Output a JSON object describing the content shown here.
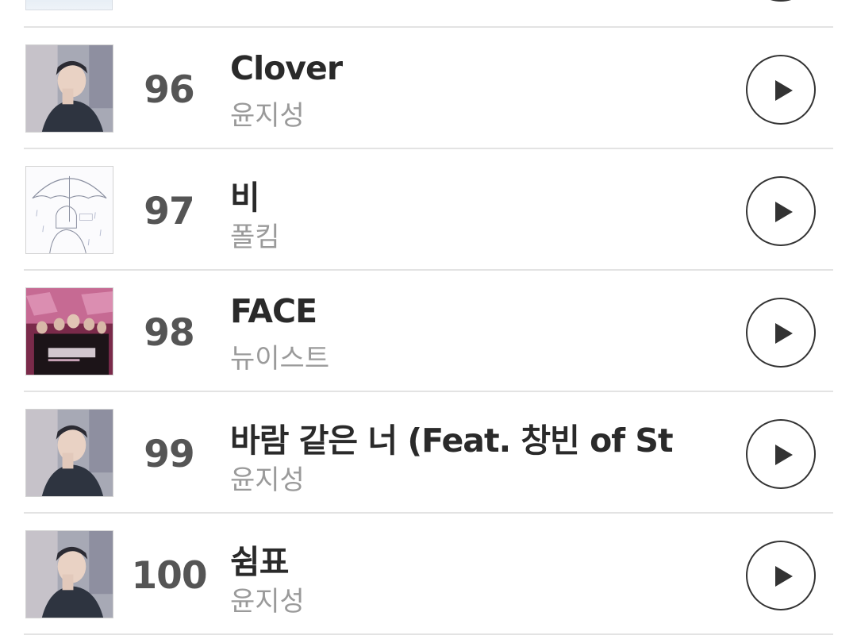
{
  "chart": {
    "rows": [
      {
        "rank": "96",
        "title": "Clover",
        "artist": "윤지성",
        "thumb": "윤지성-album-art"
      },
      {
        "rank": "97",
        "title": "비",
        "artist": "폴킴",
        "thumb": "umbrella-album-art"
      },
      {
        "rank": "98",
        "title": "FACE",
        "artist": "뉴이스트",
        "thumb": "nuest-face-album-art"
      },
      {
        "rank": "99",
        "title": "바람 같은 너 (Feat. 창빈 of St…",
        "artist": "윤지성",
        "thumb": "윤지성-album-art"
      },
      {
        "rank": "100",
        "title": "쉼표",
        "artist": "윤지성",
        "thumb": "윤지성-album-art"
      }
    ]
  },
  "icons": {
    "play": "play-icon"
  },
  "colors": {
    "rank": "#555555",
    "title": "#2a2a2a",
    "artist": "#9a9a9a",
    "divider": "#e3e3e3",
    "play_outline": "#333333"
  }
}
